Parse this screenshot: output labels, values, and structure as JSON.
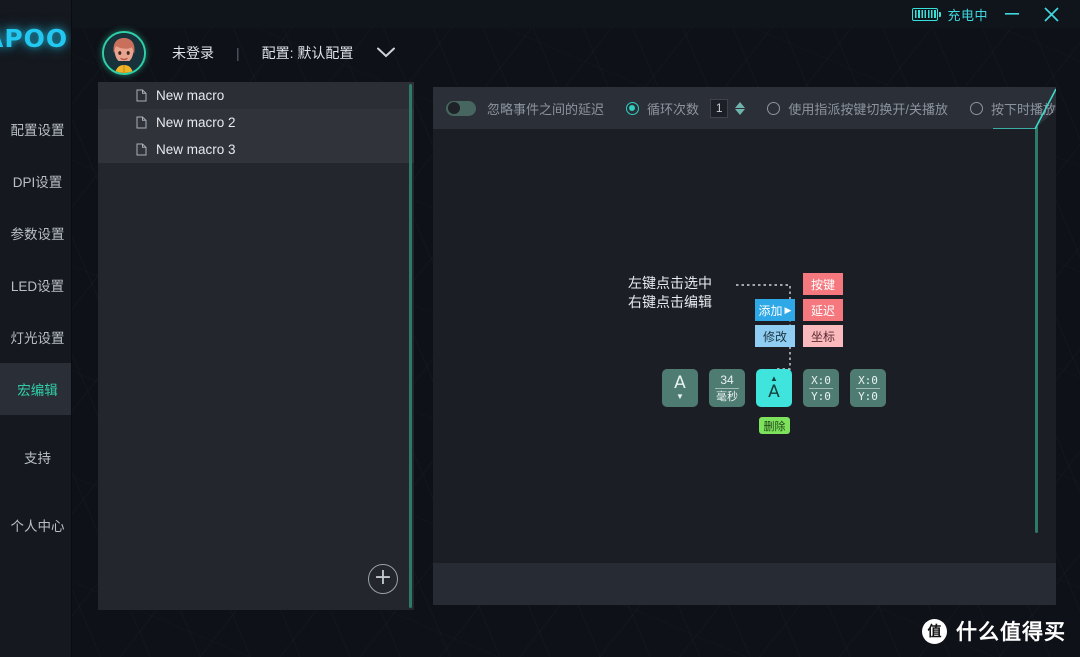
{
  "titlebar": {
    "battery_icon": "battery-charging-icon",
    "charge_status": "充电中",
    "minimize_label": "—",
    "close_label": "✕"
  },
  "sidebar": {
    "logo_text": "APOO",
    "items": [
      {
        "label": "配置设置",
        "active": false
      },
      {
        "label": "DPI设置",
        "active": false
      },
      {
        "label": "参数设置",
        "active": false
      },
      {
        "label": "LED设置",
        "active": false
      },
      {
        "label": "灯光设置",
        "active": false
      },
      {
        "label": "宏编辑",
        "active": true
      },
      {
        "label": "支持",
        "active": false
      },
      {
        "label": "个人中心",
        "active": false
      }
    ]
  },
  "header": {
    "avatar_icon": "user-avatar-icon",
    "login_status": "未登录",
    "separator": "|",
    "profile_label": "配置: 默认配置",
    "dropdown_icon": "chevron-down-icon"
  },
  "macro_list": {
    "items": [
      {
        "name": "New macro",
        "icon": "document-icon"
      },
      {
        "name": "New macro 2",
        "icon": "document-icon"
      },
      {
        "name": "New macro 3",
        "icon": "document-icon"
      }
    ],
    "add_button_label": "+"
  },
  "toolbar": {
    "ignore_delay_label": "忽略事件之间的延迟",
    "ignore_delay_on": false,
    "loop_count_label": "循环次数",
    "loop_count_selected": true,
    "loop_count_value": "1",
    "toggle_play_label": "使用指派按键切换开/关播放",
    "toggle_play_selected": false,
    "press_play_label": "按下时播放",
    "press_play_selected": false
  },
  "editor": {
    "annotation_line1": "左键点击选中",
    "annotation_line2": "右键点击编辑",
    "context_menu": {
      "add_label": "添加",
      "add_arrow": "▶",
      "modify_label": "修改",
      "submenu": [
        {
          "label": "按键"
        },
        {
          "label": "延迟"
        },
        {
          "label": "坐标"
        }
      ]
    },
    "nodes": [
      {
        "type": "key-down",
        "key": "A",
        "arrow": "▼",
        "selected": false
      },
      {
        "type": "delay",
        "value": "34",
        "unit": "毫秒",
        "selected": false
      },
      {
        "type": "key-up",
        "key": "A",
        "arrow": "▲",
        "selected": true
      },
      {
        "type": "coordinate",
        "x": "X:0",
        "y": "Y:0",
        "selected": false
      },
      {
        "type": "coordinate",
        "x": "X:0",
        "y": "Y:0",
        "selected": false
      }
    ],
    "delete_label": "删除"
  },
  "watermark": {
    "badge": "值",
    "text": "什么值得买"
  },
  "colors": {
    "accent_teal": "#2fd0a8",
    "accent_cyan": "#3fd8e0",
    "logo_blue": "#22c8f0",
    "node_green": "#4e7c72",
    "node_selected": "#3fe5dd",
    "menu_blue": "#2fa8e8",
    "menu_red": "#f4787e",
    "delete_green": "#7de25c"
  }
}
